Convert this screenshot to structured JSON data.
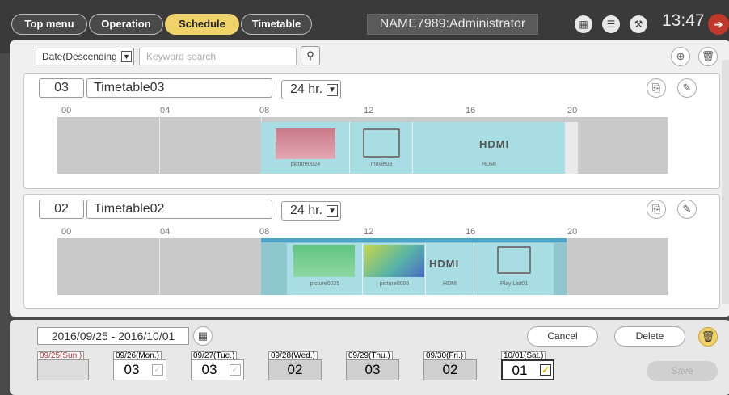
{
  "nav": {
    "tabs": [
      {
        "label": "Top menu"
      },
      {
        "label": "Operation"
      },
      {
        "label": "Schedule"
      },
      {
        "label": "Timetable"
      }
    ],
    "user": "NAME7989:Administrator",
    "clock": "13:47"
  },
  "toolbar": {
    "sort_label": "Date(Descending",
    "search_placeholder": "Keyword search"
  },
  "hours": [
    "00",
    "04",
    "08",
    "12",
    "16",
    "20"
  ],
  "timetables": [
    {
      "number": "03",
      "name": "Timetable03",
      "mode": "24 hr.",
      "items": [
        {
          "caption": "picture0024"
        },
        {
          "caption": "movie03"
        },
        {
          "caption": "HDMI",
          "logo": "HDMI"
        }
      ]
    },
    {
      "number": "02",
      "name": "Timetable02",
      "mode": "24 hr.",
      "items": [
        {
          "caption": "picture0025"
        },
        {
          "caption": "picture0006"
        },
        {
          "caption": "HDMI",
          "logo": "HDMI"
        },
        {
          "caption": "Play List01"
        }
      ]
    }
  ],
  "bottom": {
    "range": "2016/09/25 - 2016/10/01",
    "cancel": "Cancel",
    "delete": "Delete",
    "save": "Save",
    "days": [
      {
        "label": "09/25(Sun.)",
        "value": ""
      },
      {
        "label": "09/26(Mon.)",
        "value": "03"
      },
      {
        "label": "09/27(Tue.)",
        "value": "03"
      },
      {
        "label": "09/28(Wed.)",
        "value": "02"
      },
      {
        "label": "09/29(Thu.)",
        "value": "03"
      },
      {
        "label": "09/30(Fri.)",
        "value": "02"
      },
      {
        "label": "10/01(Sat.)",
        "value": "01"
      }
    ]
  },
  "colors": {
    "active_tab": "#f0d26a",
    "track": "#c9c9c9",
    "item_bg": "#a8dde3",
    "sunday": "#b03030",
    "selected_check": "#e6b800"
  }
}
